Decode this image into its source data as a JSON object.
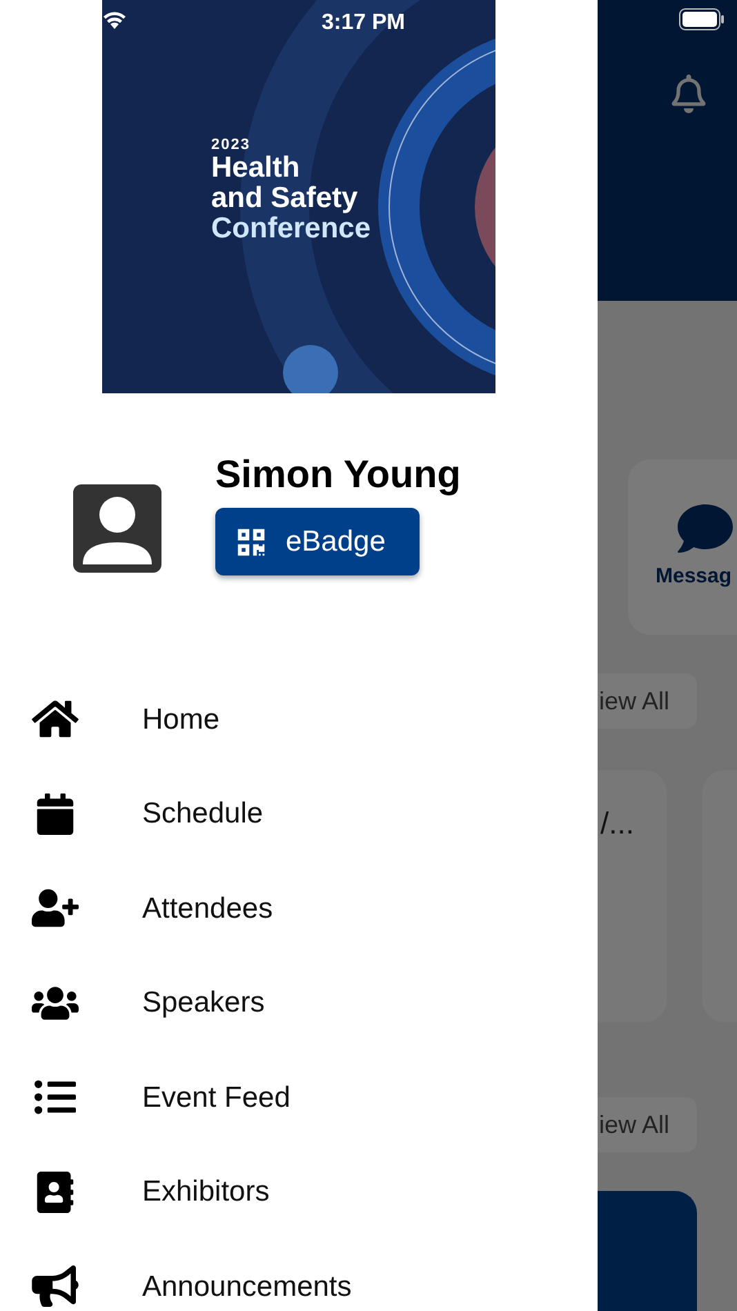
{
  "status_bar": {
    "time": "3:17 PM"
  },
  "banner": {
    "year": "2023",
    "title_lines": [
      "Health",
      "and Safety"
    ],
    "subtitle": "Conference"
  },
  "profile": {
    "name": "Simon Young",
    "badge_button": "eBadge"
  },
  "menu": [
    {
      "label": "Home"
    },
    {
      "label": "Schedule"
    },
    {
      "label": "Attendees"
    },
    {
      "label": "Speakers"
    },
    {
      "label": "Event Feed"
    },
    {
      "label": "Exhibitors"
    },
    {
      "label": "Announcements"
    }
  ],
  "background_screen": {
    "shortcut_label": "Messag",
    "view_all_buttons": [
      "iew All",
      "iew All"
    ],
    "card_text": "/..."
  }
}
